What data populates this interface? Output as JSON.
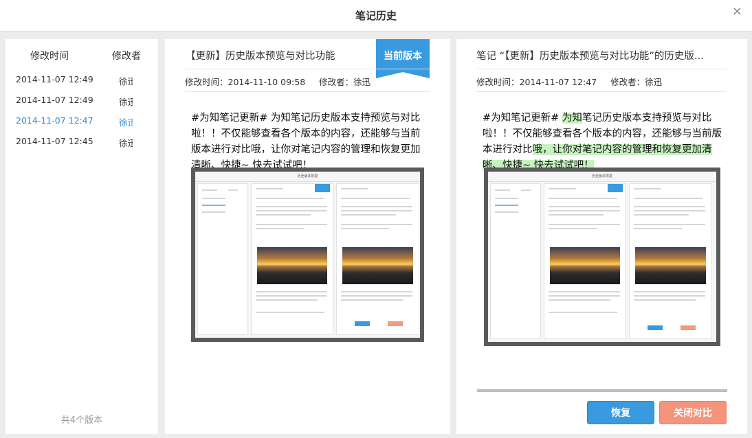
{
  "dialog": {
    "title": "笔记历史",
    "close_symbol": "×"
  },
  "versions": {
    "header_time": "修改时间",
    "header_author": "修改者",
    "items": [
      {
        "time": "2014-11-07 12:49",
        "author": "徐迅",
        "active": false
      },
      {
        "time": "2014-11-07 12:49",
        "author": "徐迅",
        "active": false
      },
      {
        "time": "2014-11-07 12:47",
        "author": "徐迅",
        "active": true
      },
      {
        "time": "2014-11-07 12:45",
        "author": "徐迅",
        "active": false
      }
    ],
    "count_label": "共4个版本"
  },
  "current": {
    "title": "【更新】历史版本预览与对比功能",
    "badge": "当前版本",
    "modified_time": "修改时间：2014-11-10 09:58",
    "modified_by": "修改者：徐迅",
    "body": "#为知笔记更新# 为知笔记历史版本支持预览与对比啦！！不仅能够查看各个版本的内容，还能够与当前版本进行对比哦，让你对笔记内容的管理和恢复更加清晰、快捷~ 快去试试吧！"
  },
  "historic": {
    "title": "笔记 “【更新】历史版本预览与对比功能”的历史版...",
    "modified_time": "修改时间：2014-11-07 12:47",
    "modified_by": "修改者：徐迅",
    "body_parts": [
      "#为知笔记更新# ",
      "为知",
      "笔记历史版本支持预览与对比啦！！不仅能够查看各个版本的内容，还能够与当前版本进行对比",
      "哦，让你对笔记内容的管理和恢复更加清晰、快捷~ 快去试试吧！"
    ],
    "restore_label": "恢复",
    "close_compare_label": "关闭对比"
  },
  "thumbnail": {
    "title": "历史版本恢复"
  },
  "colors": {
    "accent": "#3a9ae0",
    "danger": "#f5937b",
    "highlight": "#c7f2c0"
  }
}
